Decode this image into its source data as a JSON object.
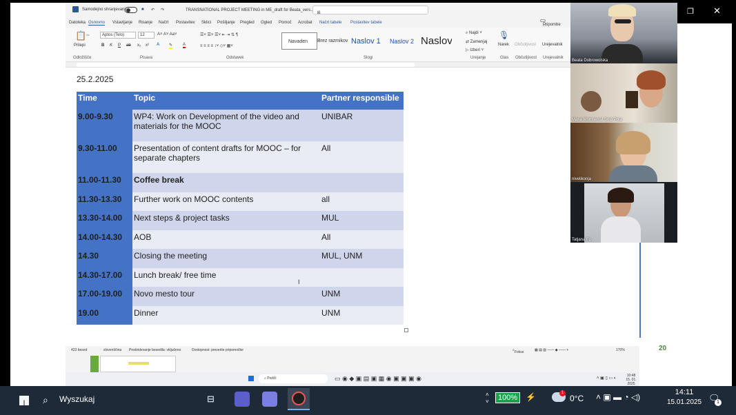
{
  "word": {
    "autosave_label": "Samodejno shranjevanje",
    "doc_title": "TRANSNATIONAL PROJECT MEETING in ME_draft for Beata_vers... ∨",
    "search_placeholder": "Iš",
    "menu": [
      "Datoteka",
      "Osnovno",
      "Vstavljanje",
      "Risanje",
      "Načrt",
      "Postavitev",
      "Sklici",
      "Pošiljanje",
      "Pregled",
      "Ogled",
      "Pomoč",
      "Acrobat",
      "Načrt tabele",
      "Postavitev tabele"
    ],
    "comments_btn": "Pripombe",
    "ribbon": {
      "paste": "Prilepi",
      "font_name": "Aptos (Telo)",
      "font_size": "12",
      "styles": [
        "Navaden",
        "Brez razmikov",
        "Naslov 1",
        "Naslov 2",
        "Naslov"
      ],
      "find": "Najdi",
      "replace": "Zamenjaj",
      "select": "Izberi",
      "dictate": "Narek",
      "sensitivity": "Občutljivost",
      "editor": "Urejevalnik",
      "groups": [
        "Odložišče",
        "Pisava",
        "Odstavek",
        "Slogi",
        "Urejanje",
        "Glas",
        "Občutljivost",
        "Urejevalnik"
      ]
    },
    "date_text": "25.2.2025",
    "table": {
      "headers": [
        "Time",
        "Topic",
        "Partner responsible"
      ],
      "rows": [
        {
          "time": "9.00-9.30",
          "topic": "WP4: Work on Development of the video and materials for the MOOC",
          "partner": "UNIBAR"
        },
        {
          "time": "9.30-11.00",
          "topic": "Presentation of content drafts for MOOC – for separate chapters",
          "partner": "All"
        },
        {
          "time": "11.00-11.30",
          "topic": "Coffee break",
          "partner": ""
        },
        {
          "time": "11.30-13.30",
          "topic": "Further work on MOOC contents",
          "partner": "all"
        },
        {
          "time": "13.30-14.00",
          "topic": "Next steps & project tasks",
          "partner": "MUL"
        },
        {
          "time": "14.00-14.30",
          "topic": "AOB",
          "partner": "All"
        },
        {
          "time": "14.30",
          "topic": "Closing the meeting",
          "partner": "MUL, UNM"
        },
        {
          "time": "14.30-17.00",
          "topic": "Lunch break/ free time",
          "partner": ""
        },
        {
          "time": "17.00-19.00",
          "topic": "Novo mesto tour",
          "partner": "UNM"
        },
        {
          "time": "19.00",
          "topic": "Dinner",
          "partner": "UNM"
        }
      ]
    },
    "status": {
      "words": "423 besed",
      "language": "slovenščina",
      "predictions": "Predvidevanje besedila: vključeno",
      "accessibility": "Dostopnost: preverite pripomočke",
      "focus": "Fokus",
      "zoom": "170%"
    },
    "inner_taskbar": {
      "search": "Poišči",
      "time": "10:48",
      "date": "15. 01. 2025"
    }
  },
  "page_number": "20",
  "participants": [
    "Beata Dobrowolska",
    "Maria Montserrat Solà Pola",
    "nivelikonja",
    "Tatjana Fo"
  ],
  "taskbar": {
    "search_placeholder": "Wyszukaj",
    "battery": "100%",
    "weather_temp": "0°C",
    "weather_badge": "1",
    "time": "14:11",
    "date": "15.01.2025",
    "notif_count": "1"
  }
}
